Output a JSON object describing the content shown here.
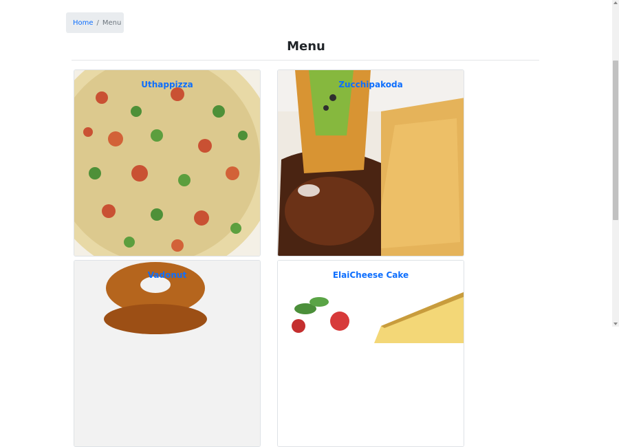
{
  "breadcrumb": {
    "home": "Home",
    "separator": "/",
    "current": "Menu"
  },
  "page": {
    "title": "Menu"
  },
  "menu_items": [
    {
      "name": "Uthappizza"
    },
    {
      "name": "Zucchipakoda"
    },
    {
      "name": "Vadonut"
    },
    {
      "name": "ElaiCheese Cake"
    }
  ],
  "colors": {
    "link": "#0d6efd",
    "breadcrumb_bg": "#e9ecef"
  }
}
